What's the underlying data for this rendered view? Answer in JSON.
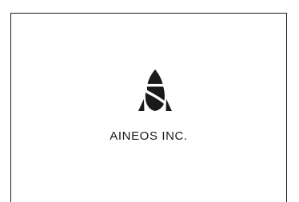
{
  "splash": {
    "brand_name": "AINEOS INC.",
    "logo_icon": "rocket-logo-icon",
    "colors": {
      "ink": "#1a1a1a",
      "background": "#ffffff"
    }
  }
}
